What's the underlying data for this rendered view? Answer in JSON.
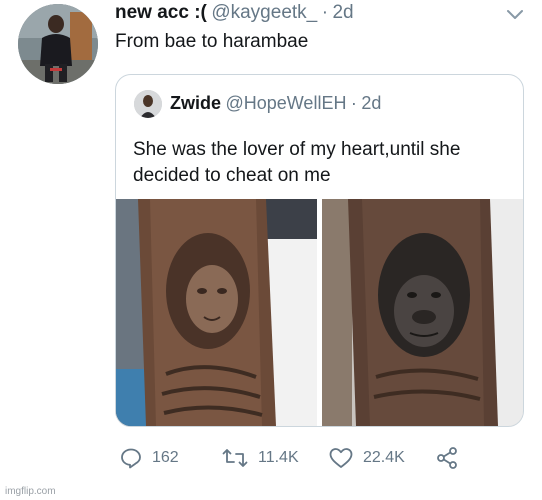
{
  "tweet": {
    "display_name": "new acc :(",
    "handle": "@kaygeetk_",
    "separator": "·",
    "time": "2d",
    "text": "From bae to harambae"
  },
  "quoted_tweet": {
    "display_name": "Zwide",
    "handle": "@HopeWellEH",
    "separator": "·",
    "time": "2d",
    "text": "She was the lover of my heart,until she decided to cheat on me"
  },
  "actions": {
    "replies": "162",
    "retweets": "11.4K",
    "likes": "22.4K"
  },
  "icons": [
    "chevron-down-icon",
    "reply-icon",
    "retweet-icon",
    "like-icon",
    "share-icon"
  ],
  "colors": {
    "text": "#14171a",
    "secondary": "#657786",
    "border": "#ccd6dd"
  },
  "watermark": "imgflip.com"
}
